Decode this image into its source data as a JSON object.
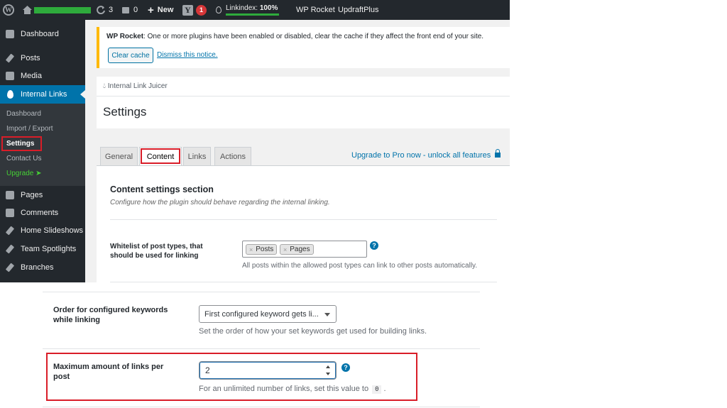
{
  "admin_bar": {
    "updates_count": "3",
    "comments_count": "0",
    "new_label": "New",
    "yoast_badge": "1",
    "linkindex_label": "Linkindex:",
    "linkindex_value": "100%",
    "wp_rocket": "WP Rocket",
    "updraftplus": "UpdraftPlus"
  },
  "sidebar": {
    "items": [
      {
        "label": "Dashboard",
        "icon": "dashboard-icon"
      },
      {
        "label": "Posts",
        "icon": "pin-icon"
      },
      {
        "label": "Media",
        "icon": "media-icon"
      },
      {
        "label": "Internal Links",
        "icon": "droplet-icon"
      },
      {
        "label": "Pages",
        "icon": "pages-icon"
      },
      {
        "label": "Comments",
        "icon": "comments-icon"
      },
      {
        "label": "Home Slideshows",
        "icon": "pin-icon"
      },
      {
        "label": "Team Spotlights",
        "icon": "pin-icon"
      },
      {
        "label": "Branches",
        "icon": "pin-icon"
      }
    ],
    "submenu": [
      "Dashboard",
      "Import / Export",
      "Settings",
      "Contact Us",
      "Upgrade"
    ]
  },
  "notice": {
    "plugin": "WP Rocket",
    "message": ": One or more plugins have been enabled or disabled, clear the cache if they affect the front end of your site.",
    "clear_cache": "Clear cache",
    "dismiss": "Dismiss this notice."
  },
  "header": {
    "brand": "Internal Link Juicer",
    "title": "Settings"
  },
  "tabs": [
    "General",
    "Content",
    "Links",
    "Actions"
  ],
  "upgrade_link": "Upgrade to Pro now - unlock all features",
  "content_section": {
    "title": "Content settings section",
    "description": "Configure how the plugin should behave regarding the internal linking.",
    "whitelist_label": "Whitelist of post types, that should be used for linking",
    "whitelist_tokens": [
      "Posts",
      "Pages"
    ],
    "whitelist_hint": "All posts within the allowed post types can link to other posts automatically."
  },
  "keyword_order": {
    "label": "Order for configured keywords while linking",
    "selected": "First configured keyword gets li...",
    "hint": "Set the order of how your set keywords get used for building links."
  },
  "max_links": {
    "label": "Maximum amount of links per post",
    "value": "2",
    "hint_prefix": "For an unlimited number of links, set this value to",
    "hint_code": "0",
    "hint_suffix": "."
  },
  "colors": {
    "admin_bar": "#23282d",
    "sidebar_active": "#0073aa",
    "highlight_red": "#d91d28",
    "notice_border": "#ffb900",
    "upgrade_green": "#46d035",
    "link_blue": "#0073aa"
  }
}
